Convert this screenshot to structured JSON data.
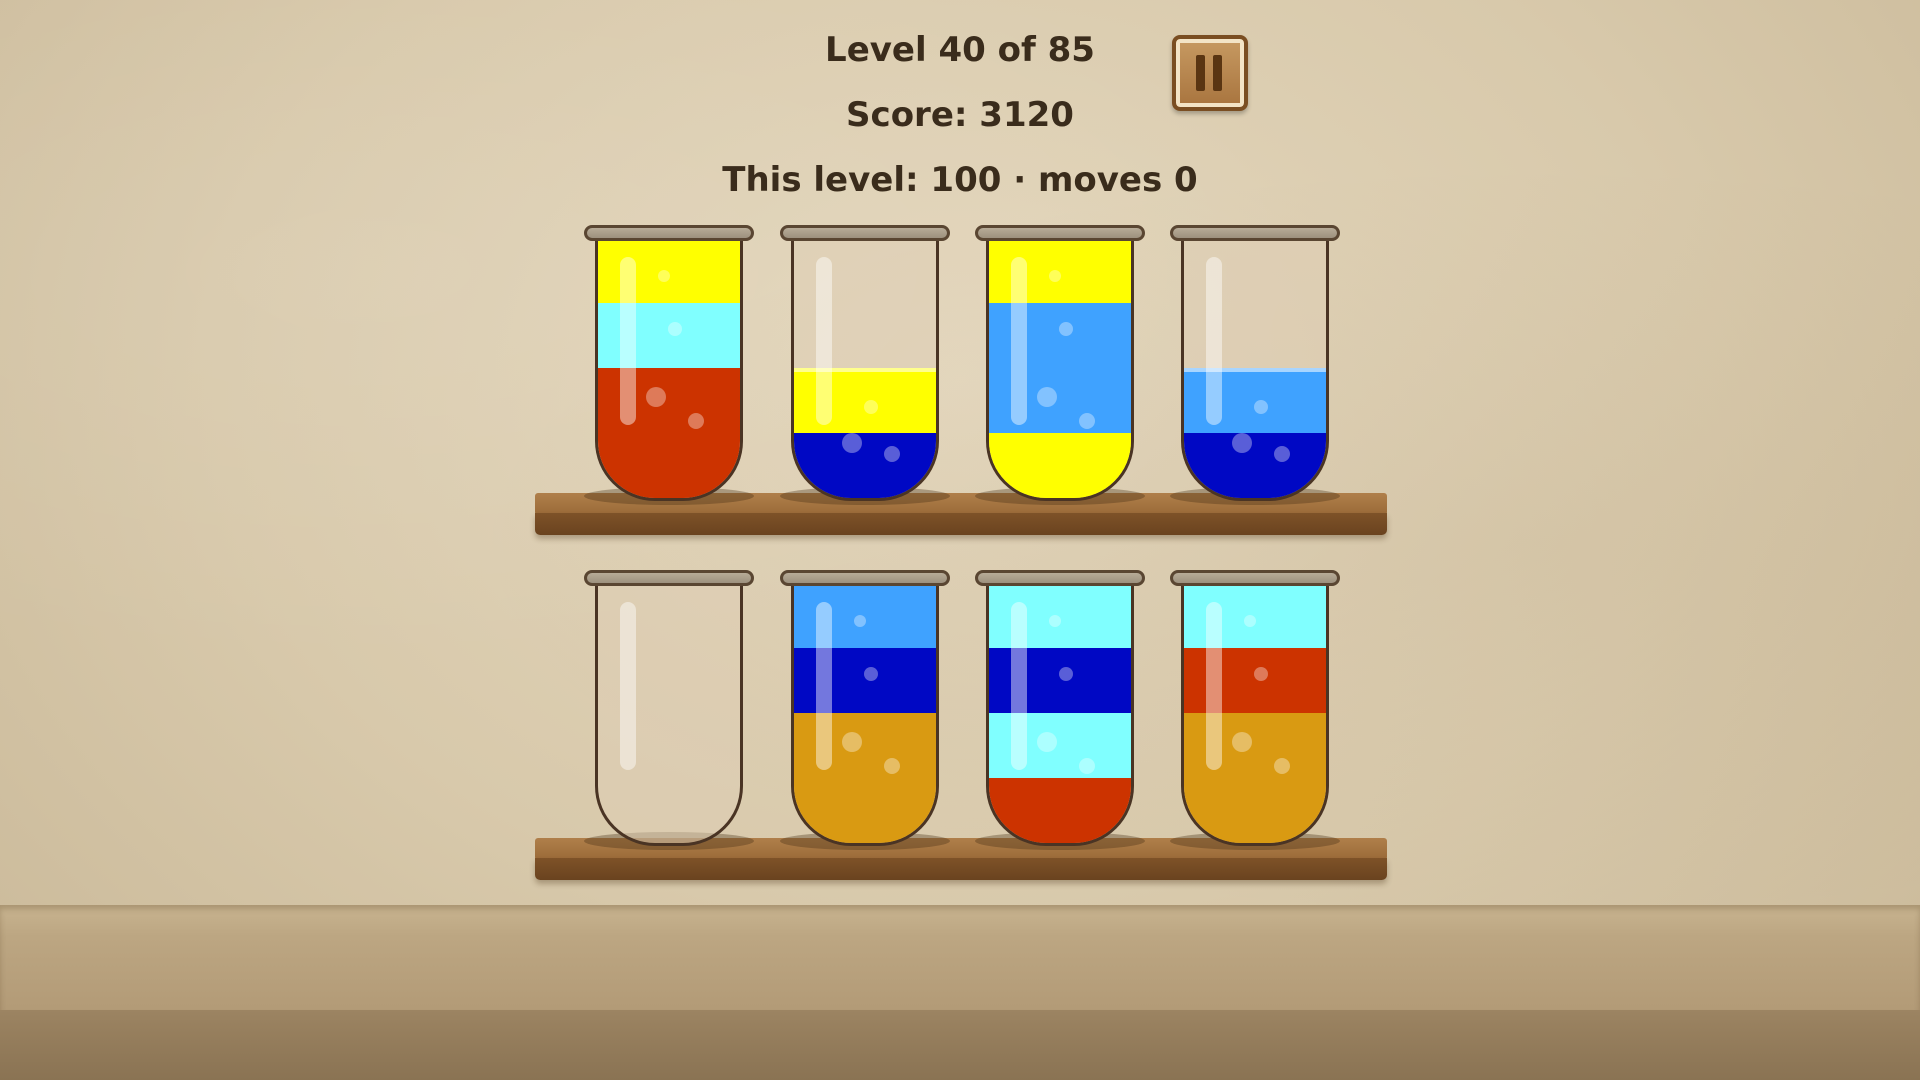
{
  "hud": {
    "level_text": "Level 40 of 85",
    "score_text": "Score: 3120",
    "level_info": "This level: 100 · moves 0"
  },
  "pause_button": {
    "icon": "pause-icon"
  },
  "colors": {
    "red": "#cc3300",
    "yellow": "#ffff00",
    "light_cyan": "#80ffff",
    "sky_blue": "#3fa2ff",
    "navy_blue": "#0008c4",
    "amber": "#d99a12"
  },
  "tube_capacity": 4,
  "shelves": [
    {
      "tubes": [
        {
          "layers_bottom_to_top": [
            "red",
            "red",
            "light_cyan",
            "yellow"
          ]
        },
        {
          "layers_bottom_to_top": [
            "navy_blue",
            "yellow"
          ]
        },
        {
          "layers_bottom_to_top": [
            "yellow",
            "sky_blue",
            "sky_blue",
            "yellow"
          ]
        },
        {
          "layers_bottom_to_top": [
            "navy_blue",
            "sky_blue"
          ]
        }
      ]
    },
    {
      "tubes": [
        {
          "layers_bottom_to_top": []
        },
        {
          "layers_bottom_to_top": [
            "amber",
            "amber",
            "navy_blue",
            "sky_blue"
          ]
        },
        {
          "layers_bottom_to_top": [
            "red",
            "light_cyan",
            "navy_blue",
            "light_cyan"
          ]
        },
        {
          "layers_bottom_to_top": [
            "amber",
            "amber",
            "red",
            "light_cyan"
          ]
        }
      ]
    }
  ]
}
